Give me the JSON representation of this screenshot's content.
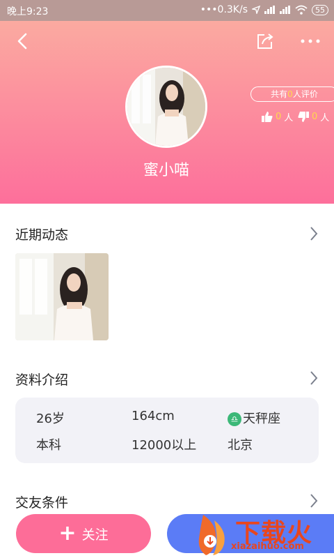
{
  "status": {
    "time": "晚上9:23",
    "speed": "0.3K/s",
    "battery": "55"
  },
  "profile": {
    "nickname": "蜜小喵",
    "review_prefix": "共有",
    "review_count": "0",
    "review_suffix": "人评价",
    "likes": "0",
    "dislikes": "0",
    "people_unit": "人"
  },
  "sections": {
    "moments_title": "近期动态",
    "profile_title": "资料介绍",
    "conditions_title": "交友条件"
  },
  "info": {
    "age": "26岁",
    "height": "164cm",
    "zodiac": "天秤座",
    "education": "本科",
    "income": "12000以上",
    "city": "北京"
  },
  "actions": {
    "follow_label": "关注"
  },
  "watermark": {
    "main": "下载火",
    "sub": "xiazaihuo.com"
  },
  "colors": {
    "accent_pink": "#fd6d98",
    "accent_blue": "#5b7cf6",
    "zodiac_green": "#3cb878"
  }
}
